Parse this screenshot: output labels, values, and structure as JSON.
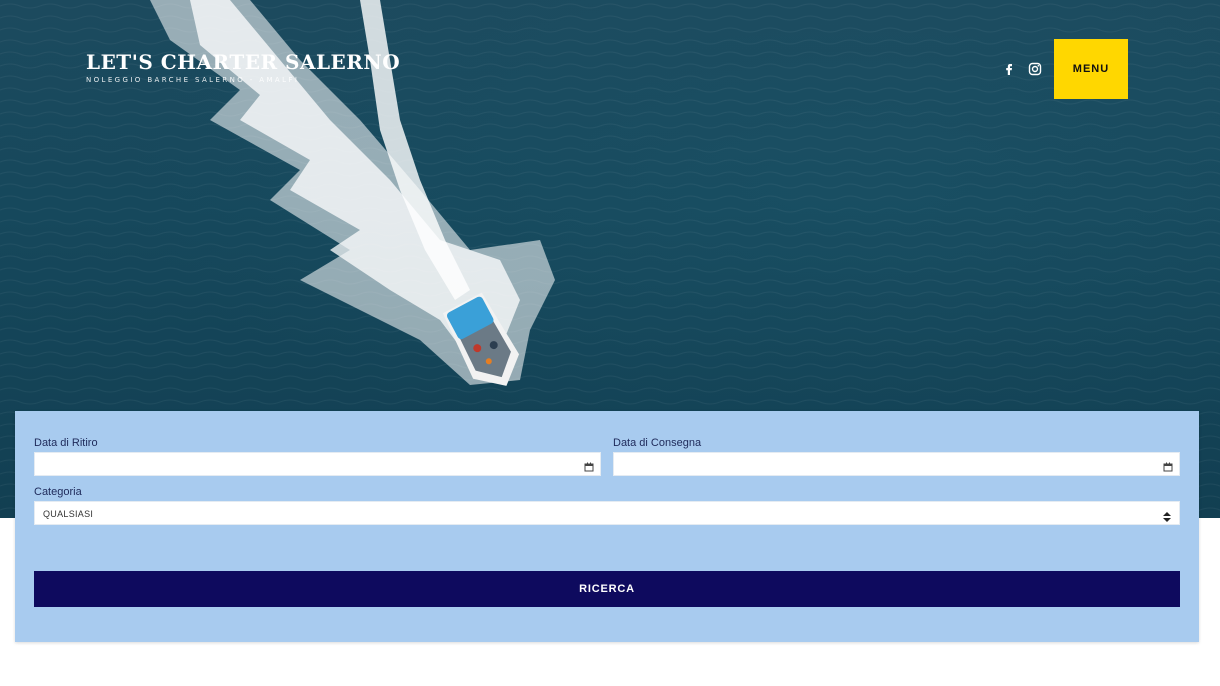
{
  "header": {
    "logo_title": "LET'S CHARTER SALERNO",
    "logo_subtitle": "NOLEGGIO BARCHE SALERNO - AMALFI",
    "social_icons": [
      "facebook-icon",
      "instagram-icon"
    ],
    "menu_label": "MENU",
    "menu_color": "#ffd700"
  },
  "search_form": {
    "pickup_label": "Data di Ritiro",
    "pickup_value": "",
    "return_label": "Data di Consegna",
    "return_value": "",
    "category_label": "Categoria",
    "category_selected": "QUALSIASI",
    "submit_label": "RICERCA",
    "panel_color": "#a8cbef",
    "button_color": "#0e0a5e"
  }
}
